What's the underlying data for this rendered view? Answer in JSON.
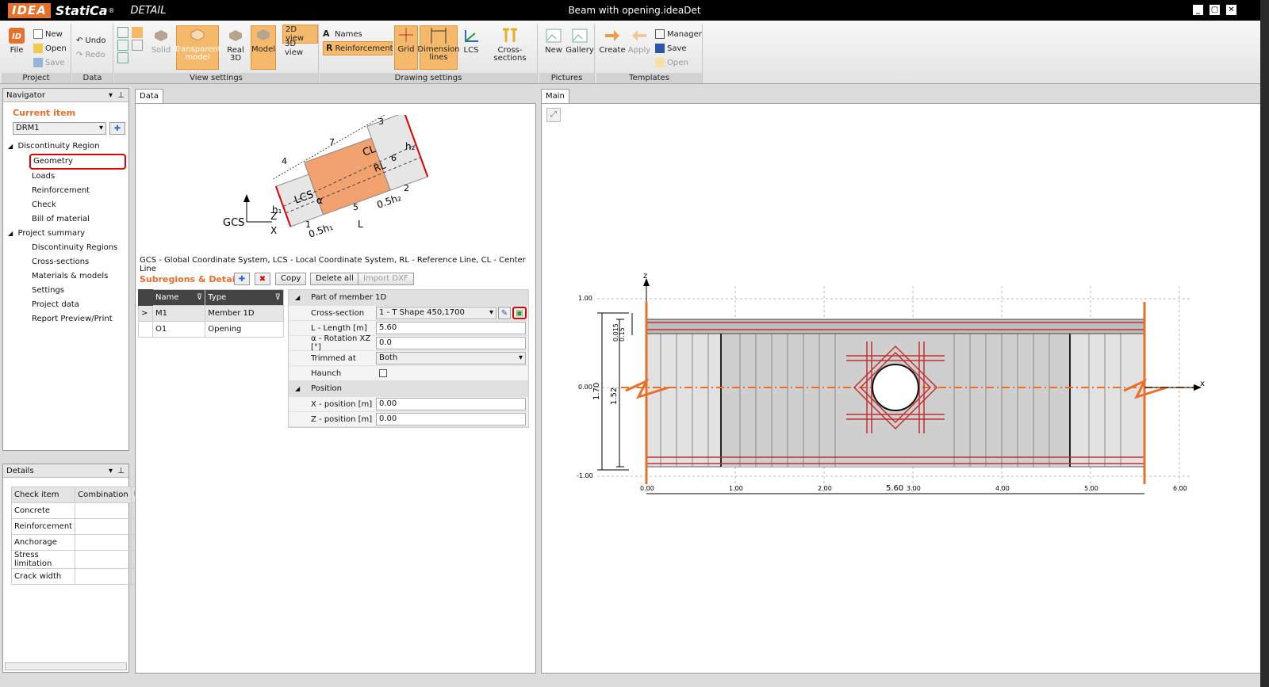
{
  "app": {
    "brand_box": "IDEA",
    "brand_name": "StatiCa",
    "brand_reg": "®",
    "product": "DETAIL",
    "document_title": "Beam with opening.ideaDet"
  },
  "ribbon": {
    "project": {
      "label": "Project",
      "file": "File",
      "new": "New",
      "open": "Open",
      "save": "Save"
    },
    "data": {
      "label": "Data",
      "undo": "Undo",
      "redo": "Redo"
    },
    "view": {
      "label": "View settings",
      "solid": "Solid",
      "transparent": "Transparent model",
      "real3d": "Real 3D",
      "model": "Model",
      "view2d": "2D view",
      "view3d": "3D view"
    },
    "drawing": {
      "label": "Drawing settings",
      "names": "Names",
      "reinforcement": "Reinforcement",
      "grid": "Grid",
      "dimension": "Dimension lines",
      "lcs": "LCS",
      "cross": "Cross-sections"
    },
    "pictures": {
      "label": "Pictures",
      "new": "New",
      "gallery": "Gallery"
    },
    "templates": {
      "label": "Templates",
      "create": "Create",
      "apply": "Apply",
      "manager": "Manager",
      "save": "Save",
      "open": "Open"
    }
  },
  "navigator": {
    "title": "Navigator",
    "current_item": "Current item",
    "selected": "DRM1",
    "region": "Discontinuity Region",
    "region_items": [
      "Geometry",
      "Loads",
      "Reinforcement",
      "Check",
      "Bill of material"
    ],
    "summary": "Project summary",
    "summary_items": [
      "Discontinuity Regions",
      "Cross-sections",
      "Materials & models",
      "Settings",
      "Project data",
      "Report Preview/Print"
    ]
  },
  "details": {
    "title": "Details",
    "columns": [
      "Check item",
      "Combination",
      "U"
    ],
    "rows": [
      "Concrete",
      "Reinforcement",
      "Anchorage",
      "Stress limitation",
      "Crack width"
    ]
  },
  "data_tab": {
    "tab": "Data",
    "sketch": {
      "gcs": "GCS",
      "z": "Z",
      "x": "X",
      "lcs": "LCS",
      "cl": "CL",
      "rl": "RL",
      "alpha": "α",
      "h1": "h₁",
      "h2": "h₂",
      "half_h1": "0.5h₁",
      "half_h2": "0.5h₂",
      "l": "L",
      "n1": "1",
      "n2": "2",
      "n3": "3",
      "n4": "4",
      "n5": "5",
      "n6": "6",
      "n7": "7"
    },
    "legend": "GCS - Global Coordinate System, LCS - Local Coordinate System, RL - Reference Line, CL - Center Line",
    "sub_title": "Subregions & Details",
    "copy": "Copy",
    "delete_all": "Delete all",
    "import_dxf": "Import DXF",
    "grid_cols": [
      "Name",
      "Type"
    ],
    "grid_rows": [
      {
        "marker": ">",
        "name": "M1",
        "type": "Member 1D"
      },
      {
        "marker": "",
        "name": "O1",
        "type": "Opening"
      }
    ],
    "props": {
      "section1": "Part of member 1D",
      "cross_label": "Cross-section",
      "cross_value": "1 - T Shape 450,1700",
      "length_label": "L - Length [m]",
      "length_value": "5.60",
      "rot_label": "α - Rotation XZ [°]",
      "rot_value": "0.0",
      "trim_label": "Trimmed at",
      "trim_value": "Both",
      "haunch_label": "Haunch",
      "section2": "Position",
      "xpos_label": "X - position [m]",
      "xpos_value": "0.00",
      "zpos_label": "Z - position [m]",
      "zpos_value": "0.00"
    }
  },
  "main_tab": {
    "tab": "Main",
    "axis": {
      "z": "z",
      "x": "x",
      "y_ticks": [
        "1.00",
        "0.00",
        "-1.00"
      ],
      "x_ticks": [
        "0.00",
        "1.00",
        "2.00",
        "3.00",
        "4.00",
        "5.00",
        "6.00"
      ]
    },
    "dims": {
      "total_h": "1.70",
      "inner_h": "1.52",
      "top_a": "0.015",
      "top_b": "0.15",
      "length": "5.60"
    }
  },
  "colors": {
    "accent": "#e8702a",
    "highlight": "#e00000",
    "rebar": "#c03030"
  }
}
